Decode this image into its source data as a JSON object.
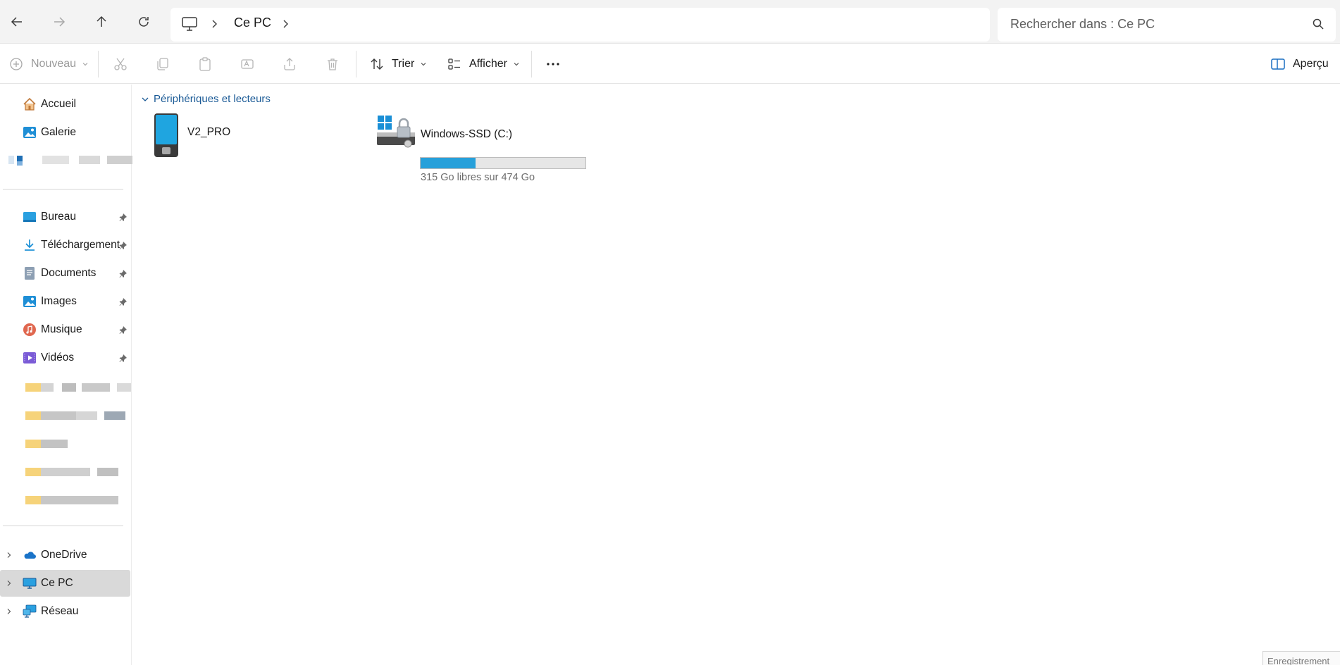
{
  "address_bar": {
    "location": "Ce PC",
    "search_placeholder": "Rechercher dans : Ce PC"
  },
  "toolbar": {
    "new_label": "Nouveau",
    "sort_label": "Trier",
    "view_label": "Afficher",
    "preview_label": "Aperçu"
  },
  "sidebar": {
    "quick": [
      {
        "label": "Accueil",
        "icon": "home-icon"
      },
      {
        "label": "Galerie",
        "icon": "gallery-icon"
      }
    ],
    "pinned": [
      {
        "label": "Bureau",
        "icon": "desktop-folder-icon"
      },
      {
        "label": "Téléchargement",
        "icon": "download-icon"
      },
      {
        "label": "Documents",
        "icon": "documents-icon"
      },
      {
        "label": "Images",
        "icon": "pictures-icon"
      },
      {
        "label": "Musique",
        "icon": "music-icon"
      },
      {
        "label": "Vidéos",
        "icon": "videos-icon"
      }
    ],
    "locations": [
      {
        "label": "OneDrive",
        "icon": "onedrive-icon"
      },
      {
        "label": "Ce PC",
        "icon": "this-pc-icon",
        "selected": true
      },
      {
        "label": "Réseau",
        "icon": "network-icon"
      }
    ]
  },
  "content": {
    "group_label": "Périphériques et lecteurs",
    "devices": [
      {
        "name": "V2_PRO",
        "icon": "phone-icon"
      },
      {
        "name": "Windows-SSD (C:)",
        "icon": "drive-icon",
        "free_text": "315 Go libres sur 474 Go",
        "used_fraction": 0.335
      }
    ]
  },
  "status_chip": "Enregistrement",
  "colors": {
    "accent": "#26a0da",
    "group_header": "#1a5a96",
    "selection": "#d9d9d9"
  }
}
